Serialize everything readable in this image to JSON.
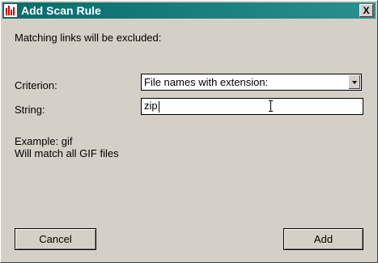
{
  "window": {
    "title": "Add Scan Rule",
    "close_glyph": "X",
    "app_icon": "bar-chart-icon"
  },
  "intro_text": "Matching links will be excluded:",
  "criterion": {
    "label": "Criterion:",
    "value": "File names with extension:"
  },
  "string": {
    "label": "String:",
    "value": "zip"
  },
  "example": {
    "line1": "Example: gif",
    "line2": "Will match all GIF files"
  },
  "buttons": {
    "cancel": "Cancel",
    "add": "Add"
  },
  "colors": {
    "titlebar": "#086b6b",
    "face": "#d4d0c8"
  }
}
